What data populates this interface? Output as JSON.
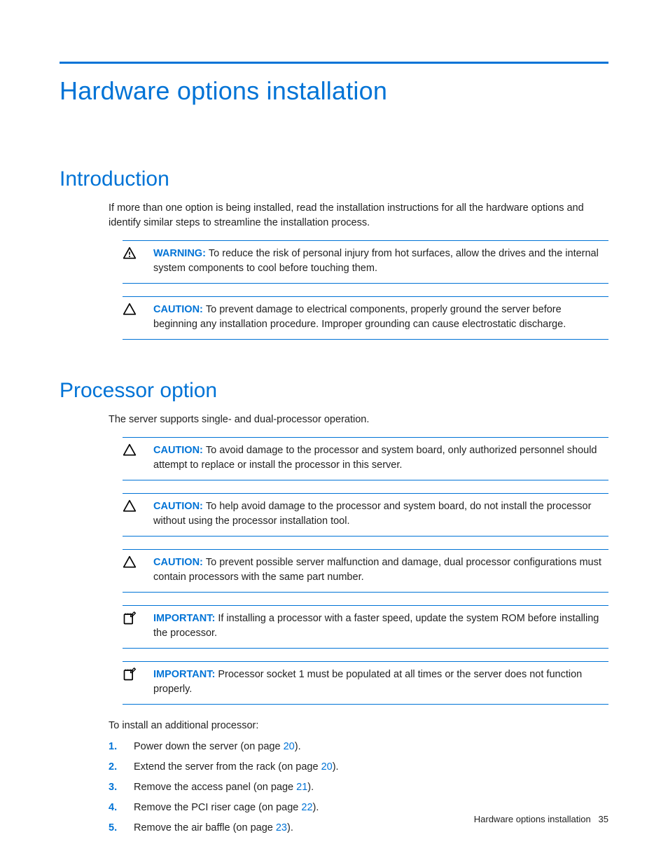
{
  "page": {
    "title": "Hardware options installation",
    "footer_section": "Hardware options installation",
    "footer_page": "35"
  },
  "intro": {
    "heading": "Introduction",
    "paragraph": "If more than one option is being installed, read the installation instructions for all the hardware options and identify similar steps to streamline the installation process.",
    "admonitions": [
      {
        "type": "warning",
        "label": "WARNING:",
        "text": "To reduce the risk of personal injury from hot surfaces, allow the drives and the internal system components to cool before touching them."
      },
      {
        "type": "caution",
        "label": "CAUTION:",
        "text": "To prevent damage to electrical components, properly ground the server before beginning any installation procedure. Improper grounding can cause electrostatic discharge."
      }
    ]
  },
  "processor": {
    "heading": "Processor option",
    "paragraph": "The server supports single- and dual-processor operation.",
    "admonitions": [
      {
        "type": "caution",
        "label": "CAUTION:",
        "text": "To avoid damage to the processor and system board, only authorized personnel should attempt to replace or install the processor in this server."
      },
      {
        "type": "caution",
        "label": "CAUTION:",
        "text": "To help avoid damage to the processor and system board, do not install the processor without using the processor installation tool."
      },
      {
        "type": "caution",
        "label": "CAUTION:",
        "text": "To prevent possible server malfunction and damage, dual processor configurations must contain processors with the same part number."
      },
      {
        "type": "important",
        "label": "IMPORTANT:",
        "text": "If installing a processor with a faster speed, update the system ROM before installing the processor."
      },
      {
        "type": "important",
        "label": "IMPORTANT:",
        "text": "Processor socket 1 must be populated at all times or the server does not function properly."
      }
    ],
    "steps_intro": "To install an additional processor:",
    "steps": [
      {
        "pre": "Power down the server (on page ",
        "link": "20",
        "post": ")."
      },
      {
        "pre": "Extend the server from the rack (on page ",
        "link": "20",
        "post": ")."
      },
      {
        "pre": "Remove the access panel (on page ",
        "link": "21",
        "post": ")."
      },
      {
        "pre": "Remove the PCI riser cage (on page ",
        "link": "22",
        "post": ")."
      },
      {
        "pre": "Remove the air baffle (on page ",
        "link": "23",
        "post": ")."
      }
    ]
  }
}
